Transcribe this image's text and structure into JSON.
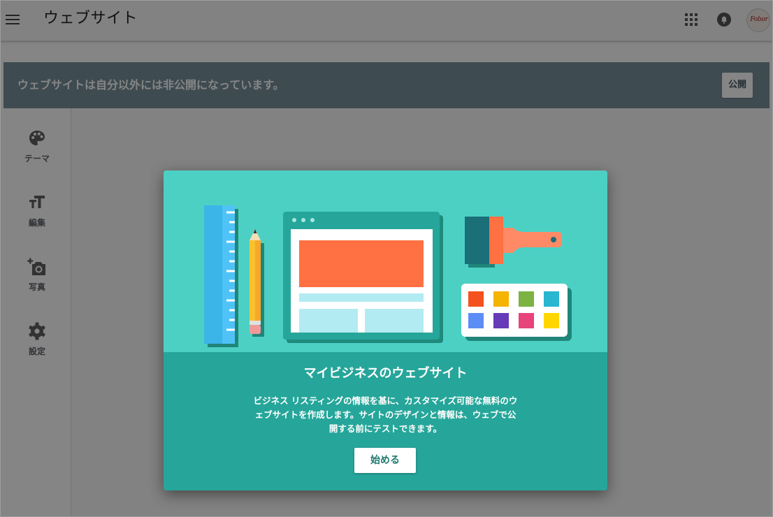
{
  "app_bar": {
    "title": "ウェブサイト",
    "icons": [
      "menu-icon",
      "apps-icon",
      "notifications-icon",
      "account-avatar"
    ],
    "avatar_text": "Fobor"
  },
  "banner": {
    "text": "ウェブサイトは自分以外には非公開になっています。",
    "publish_label": "公開",
    "color": "#78909c"
  },
  "sidebar": {
    "items": [
      {
        "label": "テーマ",
        "icon": "palette-icon"
      },
      {
        "label": "編集",
        "icon": "text-size-icon"
      },
      {
        "label": "写真",
        "icon": "add-photo-icon"
      },
      {
        "label": "設定",
        "icon": "gear-icon"
      }
    ]
  },
  "dialog": {
    "title": "マイビジネスのウェブサイト",
    "description_lines": [
      "ビジネス リスティングの情報を基に、カスタマイズ可能な無料のウ",
      "ェブサイトを作成します。サイトのデザインと情報は、ウェブで公",
      "開する前にテストできます。"
    ],
    "start_label": "始める",
    "colors": {
      "illustration_bg": "#4dd0c4",
      "body_bg": "#26a69a"
    }
  },
  "illustration": {
    "swatches": [
      "#f4511e",
      "#f4b400",
      "#7cb342",
      "#29b6d0",
      "#5c8df6",
      "#673ab7",
      "#e8437a",
      "#ffd600"
    ]
  }
}
